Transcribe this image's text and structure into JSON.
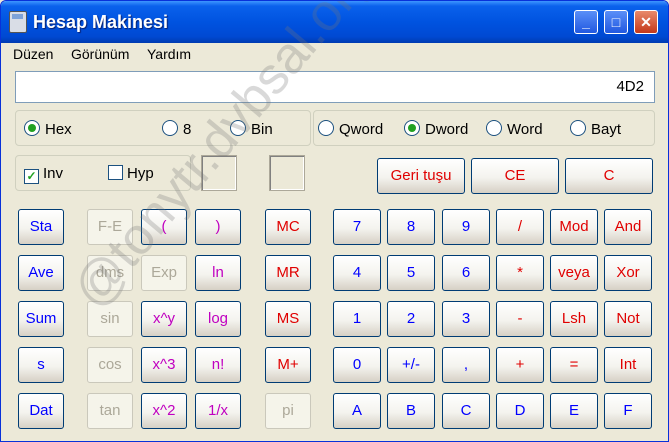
{
  "window": {
    "title": "Hesap Makinesi"
  },
  "menu": [
    "Düzen",
    "Görünüm",
    "Yardım"
  ],
  "display": {
    "value": "4D2"
  },
  "base_options": [
    {
      "label": "Hex",
      "selected": true
    },
    {
      "label": "8",
      "selected": false
    },
    {
      "label": "Bin",
      "selected": false
    }
  ],
  "size_options": [
    {
      "label": "Qword",
      "selected": false
    },
    {
      "label": "Dword",
      "selected": true
    },
    {
      "label": "Word",
      "selected": false
    },
    {
      "label": "Bayt",
      "selected": false
    }
  ],
  "checkboxes": [
    {
      "label": "Inv",
      "checked": true
    },
    {
      "label": "Hyp",
      "checked": false
    }
  ],
  "edit_buttons": [
    "Geri tuşu",
    "CE",
    "C"
  ],
  "sci_col1": [
    "Sta",
    "Ave",
    "Sum",
    "s",
    "Dat"
  ],
  "sci_col2": [
    "F-E",
    "dms",
    "sin",
    "cos",
    "tan"
  ],
  "sci_col3": [
    "(",
    "Exp",
    "x^y",
    "x^3",
    "x^2"
  ],
  "sci_col4": [
    ")",
    "ln",
    "log",
    "n!",
    "1/x"
  ],
  "mem_col": [
    "MC",
    "MR",
    "MS",
    "M+",
    "pi"
  ],
  "num_rows": [
    [
      "7",
      "8",
      "9",
      "/",
      "Mod",
      "And"
    ],
    [
      "4",
      "5",
      "6",
      "*",
      "veya",
      "Xor"
    ],
    [
      "1",
      "2",
      "3",
      "-",
      "Lsh",
      "Not"
    ],
    [
      "0",
      "+/-",
      ",",
      "+",
      "=",
      "Int"
    ],
    [
      "A",
      "B",
      "C",
      "D",
      "E",
      "F"
    ]
  ],
  "watermark": "@tonytr.dvbsal.org",
  "colors": {
    "accent": "#0054e3",
    "red_label": "#e00000",
    "blue_label": "#0000ff",
    "magenta_label": "#c000c0"
  }
}
